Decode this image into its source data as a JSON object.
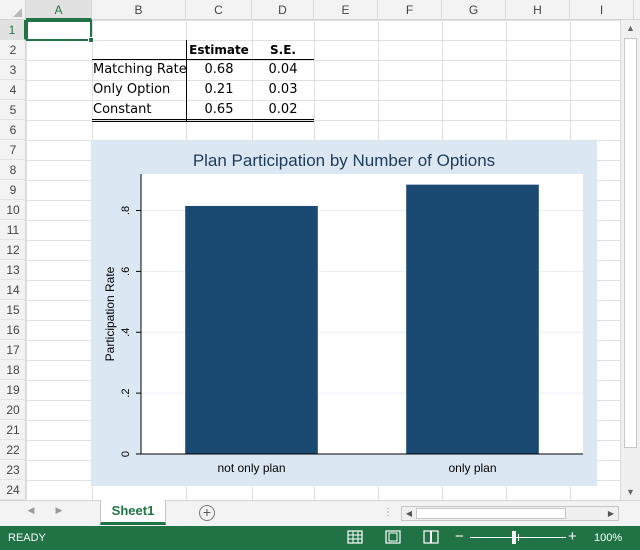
{
  "columns": [
    "A",
    "B",
    "C",
    "D",
    "E",
    "F",
    "G",
    "H",
    "I"
  ],
  "rows": [
    "1",
    "2",
    "3",
    "4",
    "5",
    "6",
    "7",
    "8",
    "9",
    "10",
    "11",
    "12",
    "13",
    "14",
    "15",
    "16",
    "17",
    "18",
    "19",
    "20",
    "21",
    "22",
    "23",
    "24"
  ],
  "table": {
    "headers": [
      "Estimate",
      "S.E."
    ],
    "rows": [
      {
        "label": "Matching Rate",
        "estimate": "0.68",
        "se": "0.04"
      },
      {
        "label": "Only Option",
        "estimate": "0.21",
        "se": "0.03"
      },
      {
        "label": "Constant",
        "estimate": "0.65",
        "se": "0.02"
      }
    ]
  },
  "chart_data": {
    "type": "bar",
    "title": "Plan Participation by Number of Options",
    "xlabel": "",
    "ylabel": "Participation Rate",
    "categories": [
      "not only plan",
      "only plan"
    ],
    "values": [
      0.815,
      0.885
    ],
    "ylim": [
      0,
      0.92
    ],
    "yticks": [
      0,
      0.2,
      0.4,
      0.6,
      0.8
    ],
    "ytick_labels": [
      "0",
      ".2",
      ".4",
      ".6",
      ".8"
    ],
    "grid": true,
    "bar_color": "#1a4a72",
    "background_color": "#dbe7f3"
  },
  "sheet_tab": "Sheet1",
  "status": {
    "text": "READY",
    "zoom": "100%"
  },
  "colors": {
    "accent": "#217346"
  }
}
